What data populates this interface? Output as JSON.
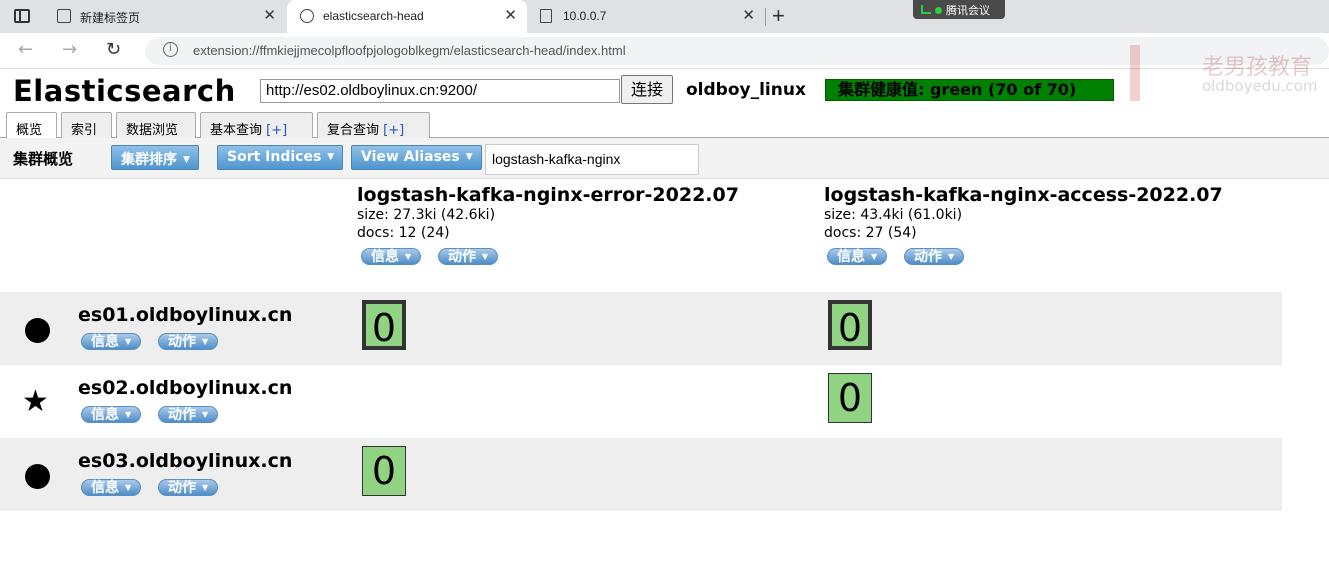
{
  "browser": {
    "tabs": [
      {
        "title": "新建标签页",
        "close": "✕"
      },
      {
        "title": "elasticsearch-head",
        "close": "✕"
      },
      {
        "title": "10.0.0.7",
        "close": "✕"
      }
    ],
    "new_tab": "+",
    "meeting_badge": "腾讯会议",
    "back": "←",
    "forward": "→",
    "reload": "↻",
    "info_glyph": "i",
    "url": "extension://ffmkiejjmecolpfloofpjologoblkegm/elasticsearch-head/index.html"
  },
  "watermark": {
    "line1": "老男孩教育",
    "line2": "oldboyedu.com"
  },
  "header": {
    "logo": "Elasticsearch",
    "es_url": "http://es02.oldboylinux.cn:9200/",
    "connect_label": "连接",
    "cluster_name": "oldboy_linux",
    "health": "集群健康值: green (70 of 70)",
    "health_color": "#008000"
  },
  "page_tabs": [
    {
      "label": "概览",
      "suffix": ""
    },
    {
      "label": "索引",
      "suffix": ""
    },
    {
      "label": "数据浏览",
      "suffix": ""
    },
    {
      "label": "基本查询 ",
      "suffix": "[+]"
    },
    {
      "label": "复合查询 ",
      "suffix": "[+]"
    }
  ],
  "toolbar": {
    "title": "集群概览",
    "sort_cluster": "集群排序",
    "sort_indices": "Sort Indices",
    "view_aliases": "View Aliases",
    "filter_value": "logstash-kafka-nginx"
  },
  "indices": [
    {
      "name": "logstash-kafka-nginx-error-2022.07",
      "size": "size: 27.3ki (42.6ki)",
      "docs": "docs: 12 (24)",
      "info": "信息",
      "action": "动作"
    },
    {
      "name": "logstash-kafka-nginx-access-2022.07",
      "size": "size: 43.4ki (61.0ki)",
      "docs": "docs: 27 (54)",
      "info": "信息",
      "action": "动作"
    }
  ],
  "nodes": [
    {
      "name": "es01.oldboylinux.cn",
      "icon": "circle-icon",
      "info": "信息",
      "action": "动作"
    },
    {
      "name": "es02.oldboylinux.cn",
      "icon": "star-icon",
      "star": "★",
      "info": "信息",
      "action": "动作"
    },
    {
      "name": "es03.oldboylinux.cn",
      "icon": "circle-icon",
      "info": "信息",
      "action": "动作"
    }
  ],
  "shards": {
    "es01_error": "0",
    "es01_access": "0",
    "es02_access": "0",
    "es03_error": "0"
  },
  "caret": "▼"
}
